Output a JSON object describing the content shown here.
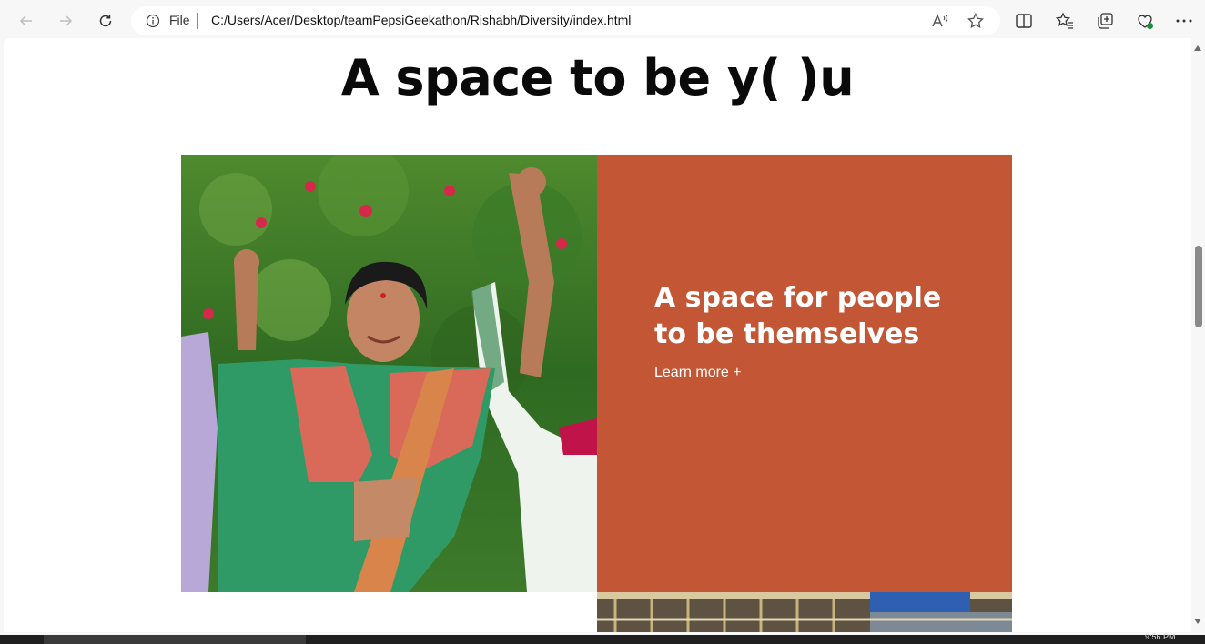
{
  "browser": {
    "address_scheme_label": "File",
    "url": "C:/Users/Acer/Desktop/teamPepsiGeekathon/Rishabh/Diversity/index.html",
    "icons": [
      "back-icon",
      "forward-icon",
      "refresh-icon",
      "info-icon",
      "read-aloud-icon",
      "favorite-star-icon",
      "split-screen-icon",
      "favorites-icon",
      "collections-icon",
      "browser-essentials-icon",
      "more-icon"
    ]
  },
  "page": {
    "headline": "A space to be y(  )u",
    "feature": {
      "title": "A space for people to be themselves",
      "link_label": "Learn more +",
      "panel_color": "#c25635"
    }
  },
  "taskbar": {
    "clock": "9:56 PM"
  }
}
